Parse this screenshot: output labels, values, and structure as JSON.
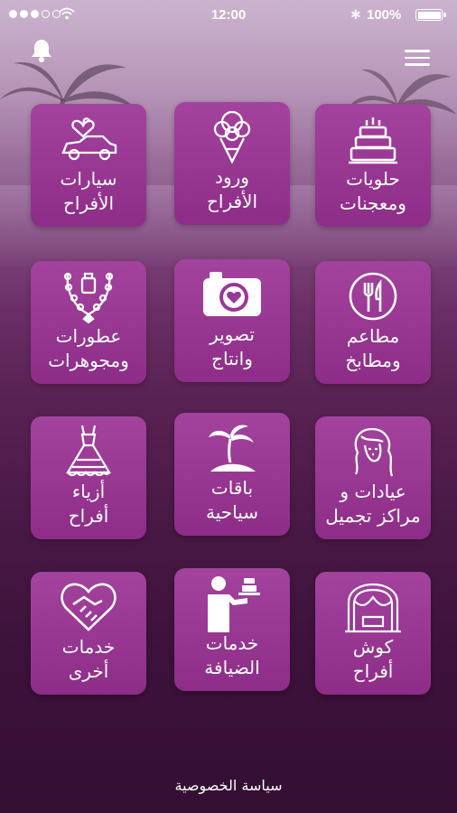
{
  "status_bar": {
    "time": "12:00",
    "battery_percent": "100%",
    "battery_level": 1.0,
    "signal_bars_filled": 3,
    "signal_bars_total": 5
  },
  "header": {
    "bell_icon": "bell-icon",
    "menu_icon": "hamburger-menu-icon"
  },
  "tiles": [
    {
      "label": "حلويات\nومعجنات",
      "icon": "cake-icon"
    },
    {
      "label": "ورود\nالأفراح",
      "icon": "bouquet-icon"
    },
    {
      "label": "سيارات\nالأفراح",
      "icon": "wedding-car-icon"
    },
    {
      "label": "مطاعم\nومطابخ",
      "icon": "fork-knife-icon"
    },
    {
      "label": "تصوير\nوانتاج",
      "icon": "camera-heart-icon"
    },
    {
      "label": "عطورات\nومجوهرات",
      "icon": "perfume-necklace-icon"
    },
    {
      "label": "عيادات و\nمراكز تجميل",
      "icon": "woman-hair-icon"
    },
    {
      "label": "باقات\nسياحية",
      "icon": "palm-island-icon"
    },
    {
      "label": "أزياء\nأفراح",
      "icon": "wedding-dress-icon"
    },
    {
      "label": "كوش\nأفراح",
      "icon": "wedding-arch-icon"
    },
    {
      "label": "خدمات\nالضيافة",
      "icon": "waiter-icon"
    },
    {
      "label": "خدمات\nأخرى",
      "icon": "handshake-heart-icon"
    }
  ],
  "footer": {
    "privacy_label": "سياسة الخصوصية"
  },
  "colors": {
    "tile": "#9a3895",
    "background_dark": "#340f32"
  }
}
